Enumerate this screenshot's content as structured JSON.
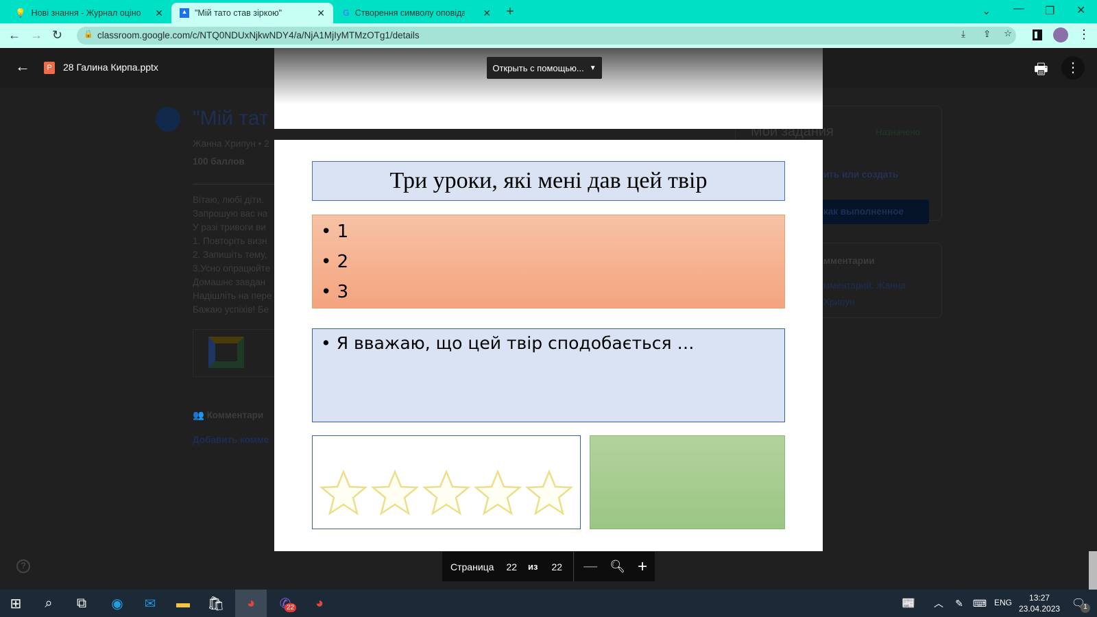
{
  "browser": {
    "tabs": [
      {
        "title": "Нові знання - Журнал оцінок - ",
        "active": false
      },
      {
        "title": "\"Мій тато став зіркою\"",
        "active": true
      },
      {
        "title": "Створення символу оповідання",
        "active": false
      }
    ],
    "url": "classroom.google.com/c/NTQ0NDUxNjkwNDY4/a/NjA1MjIyMTMzOTg1/details"
  },
  "viewer": {
    "filename": "28 Галина Кирпа.pptx",
    "open_with": "Открыть с помощью...",
    "page_label": "Страница",
    "page_current": "22",
    "of_label": "из",
    "page_total": "22"
  },
  "slide": {
    "title": "Три уроки, які мені дав цей твір",
    "bullets": [
      "1",
      "2",
      "3"
    ],
    "opinion": "Я вважаю, що цей твір сподобається …",
    "stars_total": 5
  },
  "background": {
    "assignment_title": "\"Мій тат",
    "author": "Жанна Хрипун • 2",
    "points": "100 баллов",
    "lines": [
      "Вітаю, любі діти.",
      "Запрошую вас на",
      "У разі тривоги ви",
      "1. Повторіть визн",
      "2. Запишіть тему,",
      "3.Усно опрацюйте",
      "Домашнє завдан",
      "Надішліть на пере",
      "Бажаю успіхів! Бе"
    ],
    "comments": "Комментари",
    "add_comment": "Добавить комме",
    "my_tasks": "Мои задания",
    "assigned": "Назначено",
    "add_or_create": "ить или создать",
    "mark_done": "как выполненное",
    "private_comments": "мментарии",
    "private_comment_link": "мментарий: Жанна",
    "private_comment_link2": "Хрипун"
  },
  "taskbar": {
    "time": "13:27",
    "date": "23.04.2023",
    "lang": "ENG",
    "viber_badge": "22",
    "notif_count": "1"
  }
}
